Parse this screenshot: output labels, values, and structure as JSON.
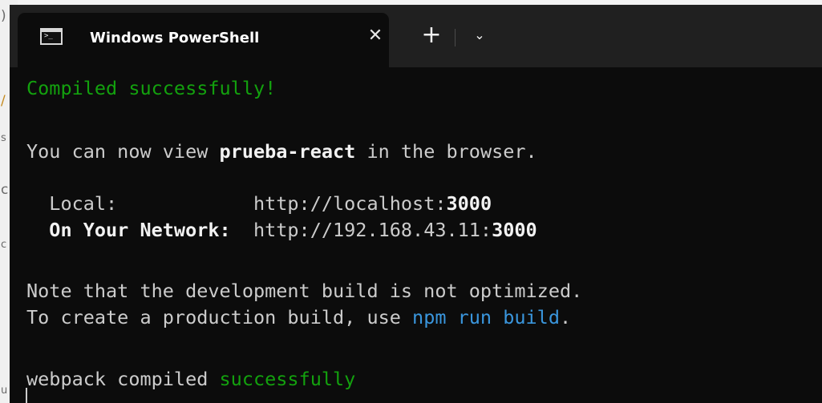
{
  "tab": {
    "icon": "powershell-icon",
    "icon_glyph": ">_",
    "title": "Windows PowerShell",
    "close_glyph": "✕"
  },
  "toolbar": {
    "new_tab_glyph": "+",
    "dropdown_glyph": "⌄"
  },
  "terminal": {
    "compiled": "Compiled successfully!",
    "view_prefix": "You can now view ",
    "app_name": "prueba-react",
    "view_suffix": " in the browser.",
    "local_label": "  Local:            ",
    "local_url_prefix": "http://localhost:",
    "local_port": "3000",
    "network_label": "  On Your Network:  ",
    "network_url_prefix": "http://192.168.43.11:",
    "network_port": "3000",
    "note1": "Note that the development build is not optimized.",
    "note2_prefix": "To create a production build, use ",
    "note2_command": "npm run build",
    "note2_suffix": ".",
    "webpack_prefix": "webpack compiled ",
    "webpack_status": "successfully"
  },
  "colors": {
    "terminal_bg": "#0c0c0c",
    "titlebar_bg": "#202020",
    "text": "#cccccc",
    "green": "#13a10e",
    "cyan": "#3a96dd",
    "bold_white": "#f2f2f2"
  }
}
